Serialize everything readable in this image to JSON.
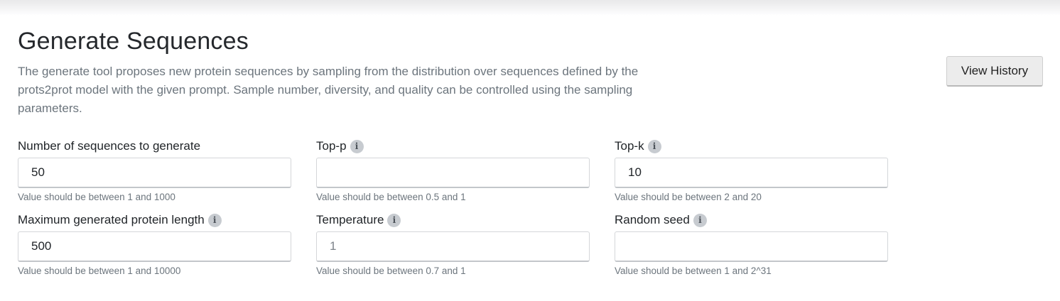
{
  "header": {
    "title": "Generate Sequences",
    "description": "The generate tool proposes new protein sequences by sampling from the distribution over sequences defined by the prots2prot model with the given prompt. Sample number, diversity, and quality can be controlled using the sampling parameters.",
    "history_button": "View History"
  },
  "icons": {
    "info": "i"
  },
  "fields": {
    "num_sequences": {
      "label": "Number of sequences to generate",
      "value": "50",
      "placeholder": "",
      "help": "Value should be between 1 and 1000"
    },
    "top_p": {
      "label": "Top-p",
      "value": "",
      "placeholder": "",
      "help": "Value should be between 0.5 and 1"
    },
    "top_k": {
      "label": "Top-k",
      "value": "10",
      "placeholder": "",
      "help": "Value should be between 2 and 20"
    },
    "max_length": {
      "label": "Maximum generated protein length",
      "value": "500",
      "placeholder": "",
      "help": "Value should be between 1 and 10000"
    },
    "temperature": {
      "label": "Temperature",
      "value": "",
      "placeholder": "1",
      "help": "Value should be between 0.7 and 1"
    },
    "random_seed": {
      "label": "Random seed",
      "value": "",
      "placeholder": "",
      "help": "Value should be between 1 and 2^31"
    }
  }
}
